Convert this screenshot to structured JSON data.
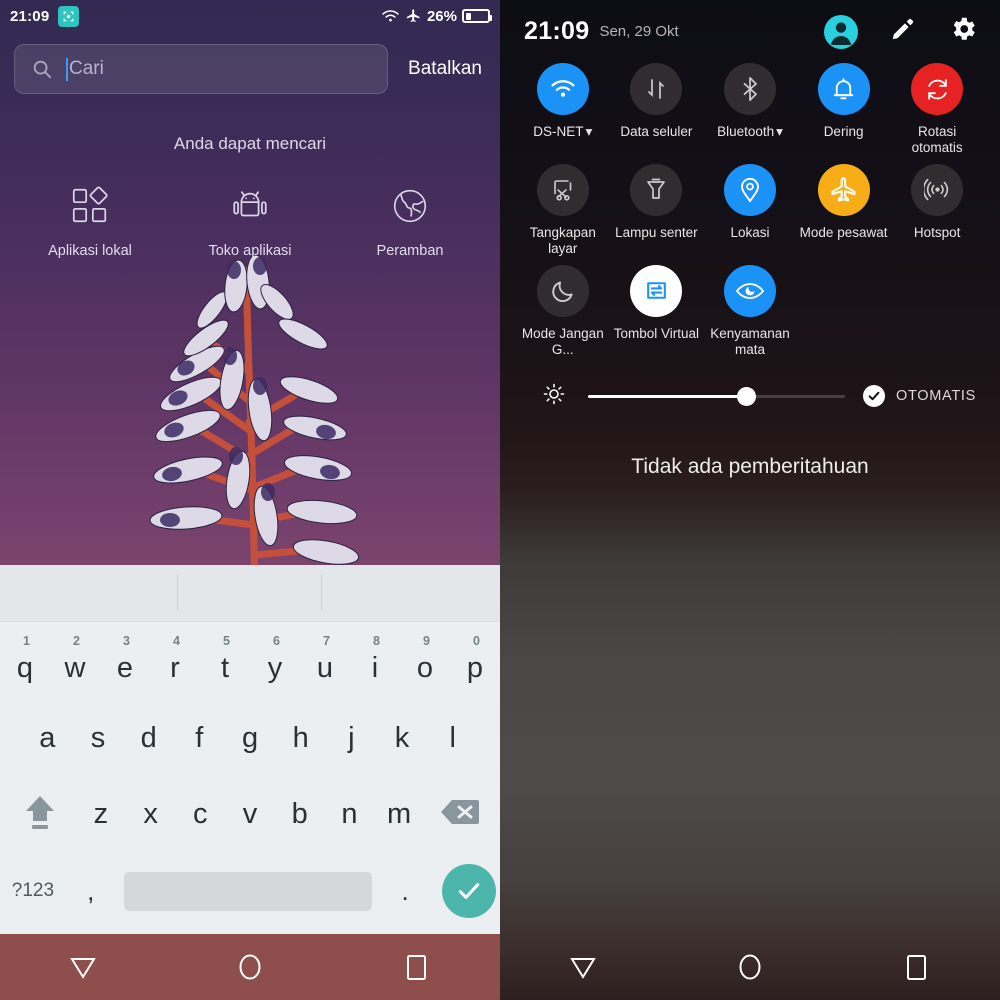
{
  "left_panel": {
    "status_bar": {
      "time": "21:09",
      "screenshot_badge_icon": "screenshot-icon",
      "wifi_icon": "wifi-icon",
      "airplane_icon": "airplane-mode-icon",
      "battery_percent": "26%",
      "battery_icon": "battery-icon"
    },
    "search": {
      "icon": "search-icon",
      "placeholder": "Cari",
      "value": "",
      "cancel_label": "Batalkan",
      "cursor_color": "#3d9cf0"
    },
    "hint": {
      "title": "Anda dapat mencari",
      "items": [
        {
          "label": "Aplikasi lokal",
          "icon": "local-apps-icon"
        },
        {
          "label": "Toko aplikasi",
          "icon": "app-store-android-icon"
        },
        {
          "label": "Peramban",
          "icon": "browser-globe-icon"
        }
      ]
    },
    "keyboard": {
      "suggestion_bar": {
        "suggestions": [
          "",
          "",
          ""
        ]
      },
      "row1": [
        {
          "key": "q",
          "num": "1"
        },
        {
          "key": "w",
          "num": "2"
        },
        {
          "key": "e",
          "num": "3"
        },
        {
          "key": "r",
          "num": "4"
        },
        {
          "key": "t",
          "num": "5"
        },
        {
          "key": "y",
          "num": "6"
        },
        {
          "key": "u",
          "num": "7"
        },
        {
          "key": "i",
          "num": "8"
        },
        {
          "key": "o",
          "num": "9"
        },
        {
          "key": "p",
          "num": "0"
        }
      ],
      "row2": [
        "a",
        "s",
        "d",
        "f",
        "g",
        "h",
        "j",
        "k",
        "l"
      ],
      "row3": {
        "shift_icon": "shift-key-icon",
        "keys": [
          "z",
          "x",
          "c",
          "v",
          "b",
          "n",
          "m"
        ],
        "backspace_icon": "backspace-key-icon"
      },
      "row4": {
        "symbols_label": "?123",
        "comma": ",",
        "space": "",
        "period": ".",
        "enter_icon": "check-enter-icon",
        "enter_color": "#4db6ac"
      }
    },
    "nav_bar": {
      "background": "#8e4f4c",
      "back_icon": "back-triangle-icon",
      "home_icon": "home-circle-icon",
      "recents_icon": "recents-square-icon"
    }
  },
  "right_panel": {
    "header": {
      "time": "21:09",
      "date": "Sen, 29 Okt",
      "avatar_icon": "user-avatar-icon",
      "avatar_color": "#29d0e0",
      "edit_icon": "edit-pencil-icon",
      "settings_icon": "gear-icon"
    },
    "tiles": [
      [
        {
          "label": "DS-NET",
          "icon": "wifi-icon",
          "state": "on",
          "color": "#1b92f5",
          "caret": "▾"
        },
        {
          "label": "Data seluler",
          "icon": "mobile-data-icon",
          "state": "off",
          "color": "#312c2f",
          "caret": ""
        },
        {
          "label": "Bluetooth",
          "icon": "bluetooth-icon",
          "state": "off",
          "color": "#312c2f",
          "caret": "▾"
        },
        {
          "label": "Dering",
          "icon": "ringer-bell-icon",
          "state": "on",
          "color": "#1b92f5",
          "caret": ""
        },
        {
          "label": "Rotasi otomatis",
          "icon": "auto-rotate-icon",
          "state": "on",
          "color": "#e62222",
          "caret": ""
        }
      ],
      [
        {
          "label": "Tangkapan layar",
          "icon": "screenshot-icon",
          "state": "off",
          "color": "#312c2f",
          "caret": ""
        },
        {
          "label": "Lampu senter",
          "icon": "flashlight-icon",
          "state": "off",
          "color": "#312c2f",
          "caret": ""
        },
        {
          "label": "Lokasi",
          "icon": "location-pin-icon",
          "state": "on",
          "color": "#1b92f5",
          "caret": ""
        },
        {
          "label": "Mode pesawat",
          "icon": "airplane-mode-icon",
          "state": "on",
          "color": "#f7ae16",
          "caret": ""
        },
        {
          "label": "Hotspot",
          "icon": "hotspot-icon",
          "state": "off",
          "color": "#312c2f",
          "caret": ""
        }
      ],
      [
        {
          "label": "Mode Jangan G...",
          "icon": "do-not-disturb-moon-icon",
          "state": "off",
          "color": "#312c2f",
          "caret": ""
        },
        {
          "label": "Tombol Virtual",
          "icon": "virtual-button-icon",
          "state": "on",
          "color": "#ffffff",
          "caret": ""
        },
        {
          "label": "Kenyamanan mata",
          "icon": "eye-comfort-icon",
          "state": "on",
          "color": "#1b92f5",
          "caret": ""
        }
      ]
    ],
    "brightness": {
      "icon": "brightness-sun-icon",
      "value_percent": 61,
      "auto_label": "OTOMATIS",
      "auto_enabled": true,
      "auto_check_icon": "check-icon"
    },
    "notifications": {
      "empty_text": "Tidak ada pemberitahuan"
    },
    "nav_bar": {
      "back_icon": "back-triangle-icon",
      "home_icon": "home-circle-icon",
      "recents_icon": "recents-square-icon"
    }
  }
}
